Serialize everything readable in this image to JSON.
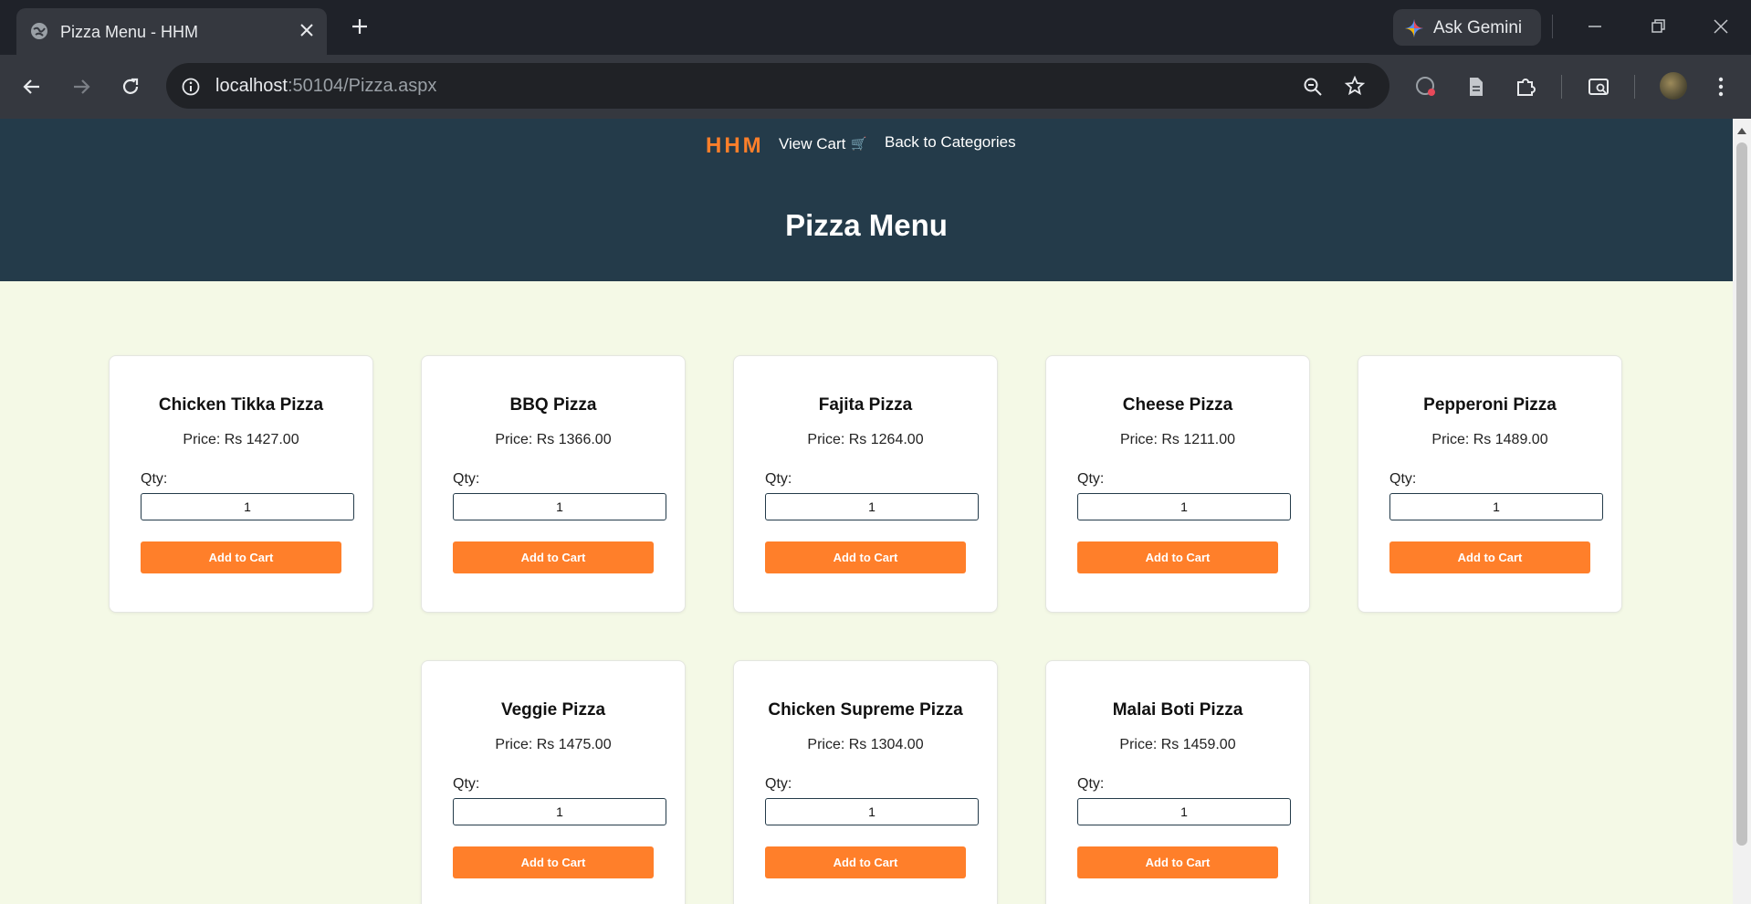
{
  "browser": {
    "tab_title": "Pizza Menu - HHM",
    "url_host": "localhost",
    "url_rest": ":50104/Pizza.aspx",
    "gemini_label": "Ask Gemini"
  },
  "site": {
    "logo": "HHM",
    "nav": {
      "view_cart": "View Cart",
      "back": "Back to Categories"
    },
    "title": "Pizza Menu",
    "qty_label": "Qty:",
    "add_label": "Add to Cart",
    "colors": {
      "header": "#243b4a",
      "accent": "#ff7f2a",
      "background": "#f4f9e6"
    }
  },
  "items": [
    {
      "name": "Chicken Tikka Pizza",
      "price": "Price: Rs 1427.00",
      "qty": "1"
    },
    {
      "name": "BBQ Pizza",
      "price": "Price: Rs 1366.00",
      "qty": "1"
    },
    {
      "name": "Fajita Pizza",
      "price": "Price: Rs 1264.00",
      "qty": "1"
    },
    {
      "name": "Cheese Pizza",
      "price": "Price: Rs 1211.00",
      "qty": "1"
    },
    {
      "name": "Pepperoni Pizza",
      "price": "Price: Rs 1489.00",
      "qty": "1"
    },
    {
      "name": "Veggie Pizza",
      "price": "Price: Rs 1475.00",
      "qty": "1"
    },
    {
      "name": "Chicken Supreme Pizza",
      "price": "Price: Rs 1304.00",
      "qty": "1"
    },
    {
      "name": "Malai Boti Pizza",
      "price": "Price: Rs 1459.00",
      "qty": "1"
    }
  ]
}
